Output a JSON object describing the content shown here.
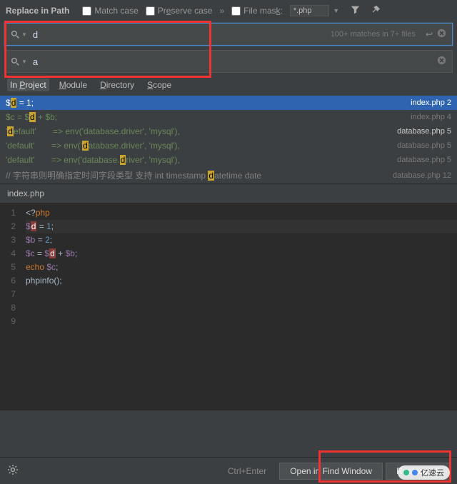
{
  "dialog": {
    "title": "Replace in Path",
    "match_case": "Match case",
    "preserve_case": "Preserve case",
    "filemask_label": "File mask:",
    "filemask_value": "*.php"
  },
  "search": {
    "find_value": "d",
    "replace_value": "a",
    "match_info": "100+ matches in 7+ files"
  },
  "scope": {
    "inproject_pre": "In",
    "inproject": "Project",
    "module": "Module",
    "directory": "Directory",
    "scope": "Scope"
  },
  "results": [
    {
      "code_pre": "$",
      "hl": "d",
      "code_post": " = 1;",
      "file": "index.php",
      "line": "2",
      "sel": true
    },
    {
      "code_pre": "$c = $",
      "hl": "d",
      "code_post": " + $b;",
      "file": "index.php",
      "line": "4",
      "sel": false
    },
    {
      "code_pre": "'",
      "hl": "d",
      "code_post": "efault'       => env('database.driver', 'mysql'),",
      "file": "database.php",
      "line": "5",
      "white": true
    },
    {
      "code_pre": "'default'       => env('",
      "hl": "d",
      "code_post": "atabase.driver', 'mysql'),",
      "file": "database.php",
      "line": "5"
    },
    {
      "code_pre": "'default'       => env('database.",
      "hl": "d",
      "code_post": "river', 'mysql'),",
      "file": "database.php",
      "line": "5"
    },
    {
      "code_pre": "// 字符串则明确指定时间字段类型 支持 int timestamp ",
      "hl": "d",
      "code_post": "atetime date",
      "file": "database.php",
      "line": "12",
      "cmt": true
    }
  ],
  "preview": {
    "filename": "index.php",
    "lines": [
      {
        "n": "1",
        "html": "<span class='op'>&lt;?</span><span class='kw'>php</span>"
      },
      {
        "n": "2",
        "html": "<span class='var'>$</span><span class='hl2'>d</span> <span class='op'>=</span> <span class='num'>1</span><span class='op'>;</span>",
        "current": true
      },
      {
        "n": "3",
        "html": "<span class='var'>$b</span> <span class='op'>=</span> <span class='num'>2</span><span class='op'>;</span>"
      },
      {
        "n": "4",
        "html": "<span class='var'>$c</span> <span class='op'>=</span> <span class='var'>$</span><span class='hl2'>d</span> <span class='op'>+</span> <span class='var'>$b</span><span class='op'>;</span>"
      },
      {
        "n": "5",
        "html": "<span class='kw'>echo</span> <span class='var'>$c</span><span class='op'>;</span>"
      },
      {
        "n": "6",
        "html": "<span class='op'>phpinfo();</span>"
      },
      {
        "n": "7",
        "html": ""
      },
      {
        "n": "8",
        "html": ""
      },
      {
        "n": "9",
        "html": ""
      }
    ]
  },
  "footer": {
    "hint": "Ctrl+Enter",
    "open": "Open in Find Window",
    "replace_all_pre": "Replace ",
    "replace_all_u": "A",
    "replace_all_post": "ll"
  },
  "watermark": "亿速云"
}
